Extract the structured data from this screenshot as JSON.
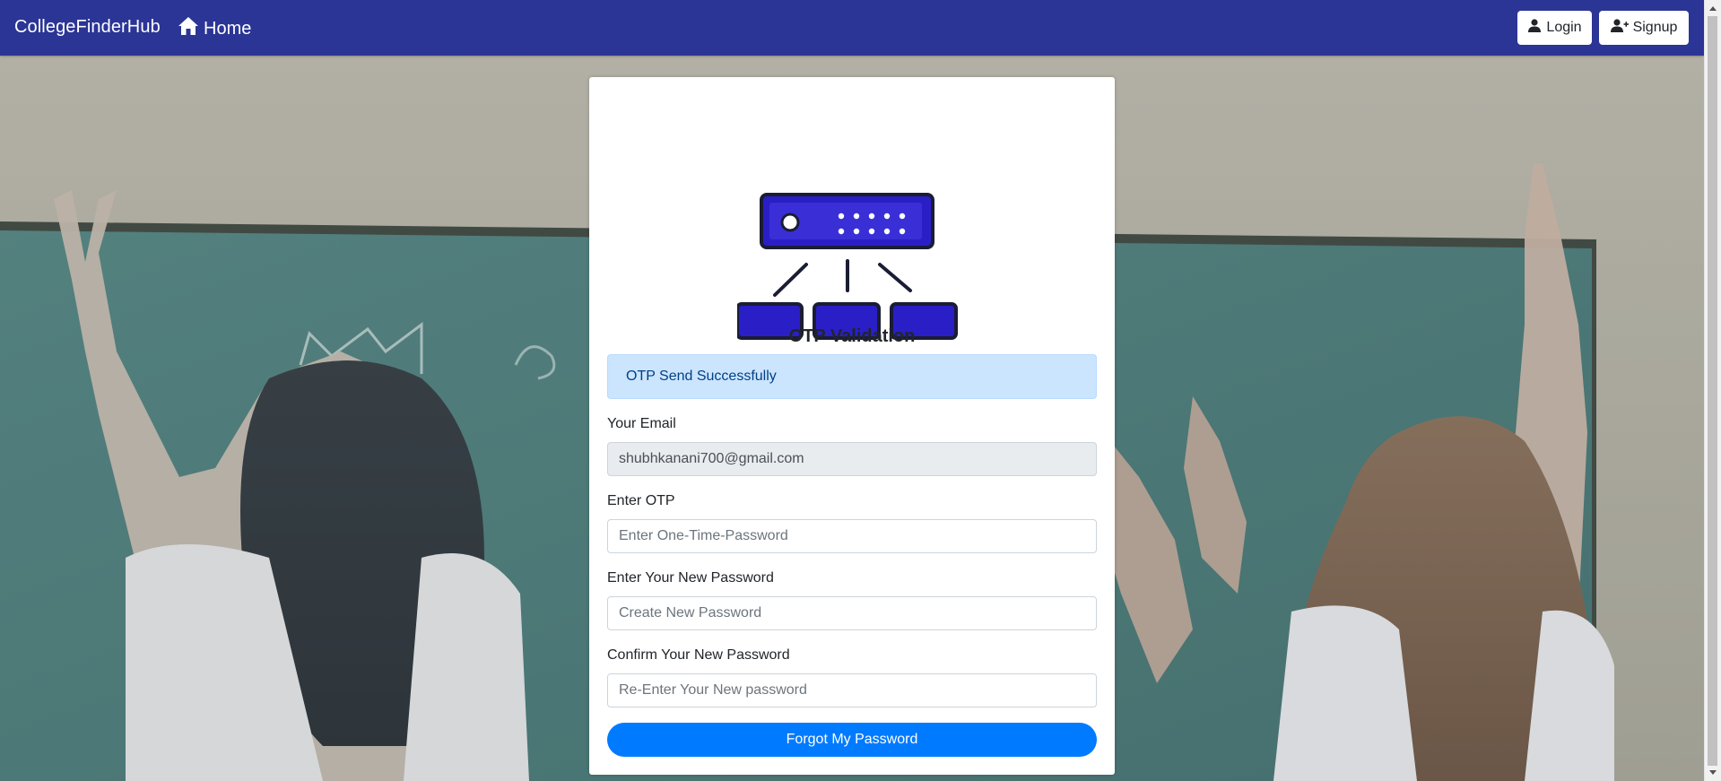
{
  "navbar": {
    "brand": "CollegeFinderHub",
    "home_label": "Home",
    "login_label": "Login",
    "signup_label": "Signup",
    "background_color": "#2b3595"
  },
  "form": {
    "title": "OTP Validation",
    "alert_message": "OTP Send Successfully",
    "email_label": "Your Email",
    "email_value": "shubhkanani700@gmail.com",
    "otp_label": "Enter OTP",
    "otp_placeholder": "Enter One-Time-Password",
    "new_password_label": "Enter Your New Password",
    "new_password_placeholder": "Create New Password",
    "confirm_password_label": "Confirm Your New Password",
    "confirm_password_placeholder": "Re-Enter Your New password",
    "submit_label": "Forgot My Password"
  },
  "colors": {
    "primary_button": "#007bff",
    "alert_background": "#cce5ff",
    "alert_text": "#004085",
    "illustration_blue": "#2a1fc7"
  },
  "icons": {
    "home": "home-icon",
    "login": "user-icon",
    "signup": "user-plus-icon",
    "illustration": "network-hierarchy-icon"
  }
}
